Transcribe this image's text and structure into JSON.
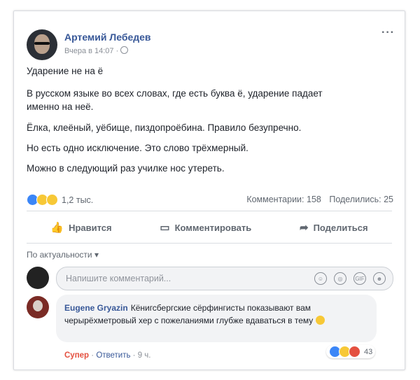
{
  "post": {
    "author": "Артемий Лебедев",
    "meta": "Вчера в 14:07 ·",
    "more": "···",
    "lines": [
      "Ударение не на ё",
      "В русском языке во всех словах, где есть буква ё, ударение падает",
      "именно на неё.",
      "Ёлка, клеёный, уёбище, пиздопроёбина. Правило безупречно.",
      "Но есть одно исключение. Это слово трёхмерный.",
      "Можно в следующий раз училке нос утереть."
    ]
  },
  "reactions": {
    "count": "1,2 тыс.",
    "comments": "Комментарии: 158",
    "shares": "Поделились: 25"
  },
  "actions": {
    "like": "Нравится",
    "comment": "Комментировать",
    "share": "Поделиться"
  },
  "comments": {
    "sort": "По актуальности ▾",
    "placeholder": "Напишите комментарий...",
    "input_icons": [
      "☺",
      "◎",
      "GIF",
      "☻"
    ],
    "item": {
      "name": "Eugene Gryazin",
      "text": "Кёнигсбергские сёрфингисты показывают вам черырёхметровый хер с пожеланиями глубже вдаваться в тему",
      "reaction_count": "43",
      "super": "Супер",
      "reply": "Ответить",
      "time": "9 ч."
    }
  },
  "colors": {
    "link": "#385898",
    "like": "#3b86f7",
    "haha": "#f7c836",
    "angry": "#e4503f"
  }
}
